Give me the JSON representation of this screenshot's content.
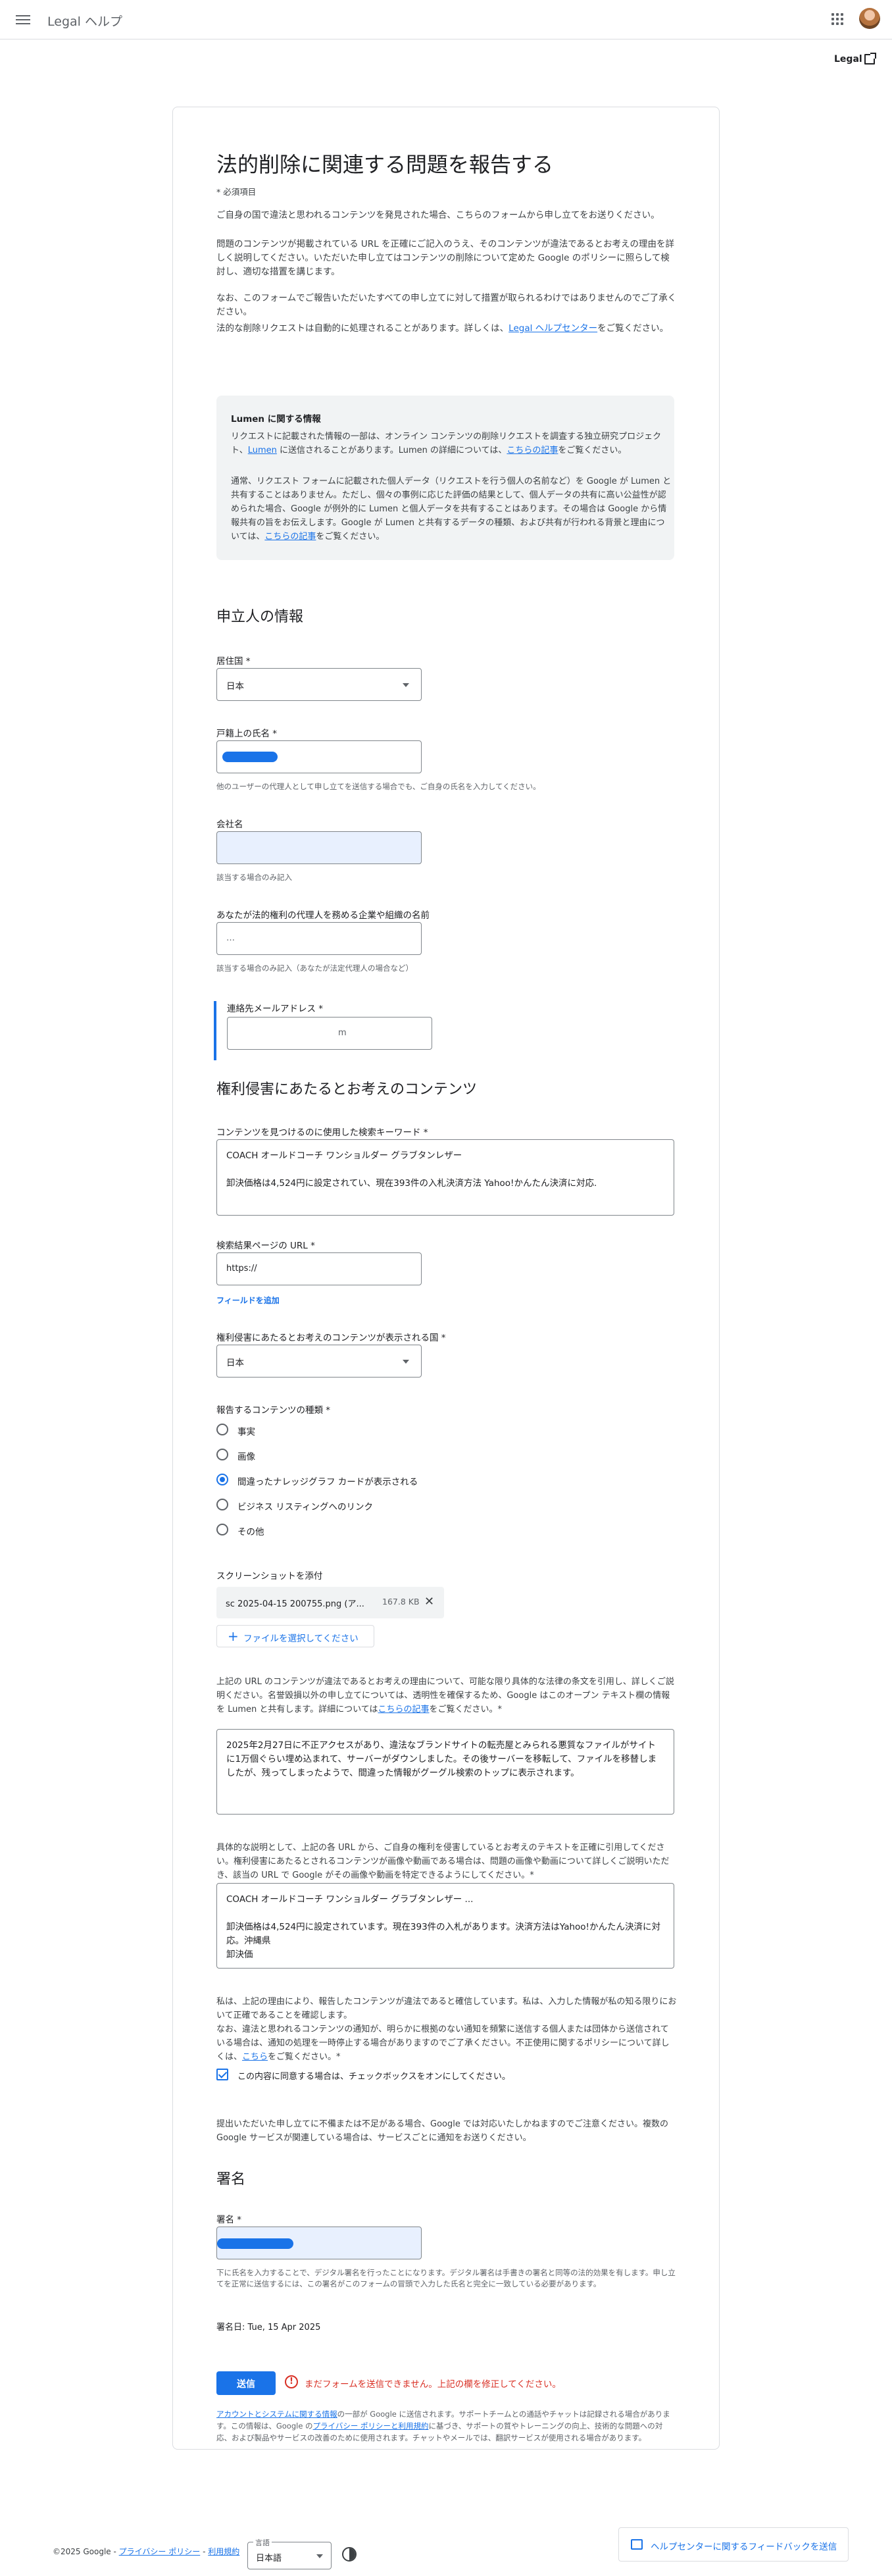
{
  "topbar": {
    "brand": "Legal ヘルプ",
    "legal_link": "Legal"
  },
  "form": {
    "title": "法的削除に関連する問題を報告する",
    "required_note": "* 必須項目",
    "intro": [
      "ご自身の国で違法と思われるコンテンツを発見された場合、こちらのフォームから申し立てをお送りください。",
      "問題のコンテンツが掲載されている URL を正確にご記入のうえ、そのコンテンツが違法であるとお考えの理由を詳しく説明してください。いただいた申し立てはコンテンツの削除について定めた Google のポリシーに照らして検討し、適切な措置を講じます。",
      "なお、このフォームでご報告いただいたすべての申し立てに対して措置が取られるわけではありませんのでご了承ください。"
    ],
    "intro_auto_prefix": "法的な削除リクエストは自動的に処理されることがあります。詳しくは、",
    "intro_auto_link": "Legal ヘルプセンター",
    "intro_auto_suffix": "をご覧ください。",
    "lumen": {
      "heading": "Lumen に関する情報",
      "p1_prefix": "リクエストに記載された情報の一部は、オンライン コンテンツの削除リクエストを調査する独立研究プロジェクト、",
      "p1_link": "Lumen",
      "p1_mid": " に送信されることがあります。Lumen の詳細については、",
      "p1_link2": "こちらの記事",
      "p1_suffix": "をご覧ください。",
      "p2_prefix": "通常、リクエスト フォームに記載された個人データ（リクエストを行う個人の名前など）を Google が Lumen と共有することはありません。ただし、個々の事例に応じた評価の結果として、個人データの共有に高い公益性が認められた場合、Google が例外的に Lumen と個人データを共有することはあります。その場合は Google から情報共有の旨をお伝えします。Google が Lumen と共有するデータの種類、および共有が行われる背景と理由については、",
      "p2_link": "こちらの記事",
      "p2_suffix": "をご覧ください。"
    },
    "requester_section": "申立人の情報",
    "country_label": "居住国 *",
    "country_value": "日本",
    "legal_name_label": "戸籍上の氏名 *",
    "legal_name_help": "他のユーザーの代理人として申し立てを送信する場合でも、ご自身の氏名を入力してください。",
    "company_label": "会社名",
    "company_help": "該当する場合のみ記入",
    "represent_label": "あなたが法的権利の代理人を務める企業や組織の名前",
    "represent_value": "…",
    "represent_help": "該当する場合のみ記入（あなたが法定代理人の場合など）",
    "email_label": "連絡先メールアドレス *",
    "email_value": "m",
    "content_section": "権利侵害にあたるとお考えのコンテンツ",
    "keywords_label": "コンテンツを見つけるのに使用した検索キーワード *",
    "keywords_value": "COACH オールドコーチ ワンショルダー グラブタンレザー\n\n卸決価格は4,524円に設定されてい、現在393件の入札決済方法 Yahoo!かんたん決済に対応.",
    "url_label": "検索結果ページの URL *",
    "url_value": "https://",
    "add_field": "フィールドを追加",
    "shown_country_label": "権利侵害にあたるとお考えのコンテンツが表示される国 *",
    "shown_country_value": "日本",
    "content_type_label": "報告するコンテンツの種類 *",
    "content_types": [
      "事実",
      "画像",
      "間違ったナレッジグラフ カードが表示される",
      "ビジネス リスティングへのリンク",
      "その他"
    ],
    "content_type_selected": 2,
    "screenshot_label": "スクリーンショットを添付",
    "file_name": "sc 2025-04-15 200755.png (ア...",
    "file_size": "167.8 KB",
    "choose_file": "ファイルを選択してください",
    "reason_label_prefix": "上記の URL のコンテンツが違法であるとお考えの理由について、可能な限り具体的な法律の条文を引用し、詳しくご説明ください。名誉毀損以外の申し立てについては、透明性を確保するため、Google はこのオープン テキスト欄の情報を Lumen と共有します。詳細については",
    "reason_label_link": "こちらの記事",
    "reason_label_suffix": "をご覧ください。*",
    "reason_value": "2025年2月27日に不正アクセスがあり、違法なブランドサイトの転売屋とみられる悪質なファイルがサイトに1万個ぐらい埋め込まれて、サーバーがダウンしました。その後サーバーを移転して、ファイルを移替しましたが、残ってしまったようで、間違った情報がグーグル検索のトップに表示されます。",
    "quote_label": "具体的な説明として、上記の各 URL から、ご自身の権利を侵害しているとお考えのテキストを正確に引用してください。権利侵害にあたるとされるコンテンツが画像や動画である場合は、問題の画像や動画について詳しくご説明いただき、該当の URL で Google がその画像や動画を特定できるようにしてください。*",
    "quote_value": "COACH オールドコーチ ワンショルダー グラブタンレザー ...\n\n卸決価格は4,524円に設定されています。現在393件の入札があります。決済方法はYahoo!かんたん決済に対応。沖縄県\n卸決価",
    "declaration_text": "私は、上記の理由により、報告したコンテンツが違法であると確信しています。私は、入力した情報が私の知る限りにおいて正確であることを確認します。\nなお、違法と思われるコンテンツの通知が、明らかに根拠のない通知を頻繁に送信する個人または団体から送信されている場合は、通知の処理を一時停止する場合がありますのでご了承ください。不正使用に関するポリシーについて詳しくは、",
    "declaration_link": "こちら",
    "declaration_suffix": "をご覧ください。*",
    "agree_label": "この内容に同意する場合は、チェックボックスをオンにしてください。",
    "notice": "提出いただいた申し立てに不備または不足がある場合、Google では対応いたしかねますのでご注意ください。複数の Google サービスが関連している場合は、サービスごとに通知をお送りください。",
    "signature_section": "署名",
    "signature_label": "署名 *",
    "signature_help": "下に氏名を入力することで、デジタル署名を行ったことになります。デジタル署名は手書きの署名と同等の法的効果を有します。申し立てを正常に送信するには、この署名がこのフォームの冒頭で入力した氏名と完全に一致している必要があります。",
    "signed_on": "署名日: Tue, 15 Apr 2025",
    "submit": "送信",
    "error": "まだフォームを送信できません。上記の欄を修正してください。",
    "footer_note_link": "アカウントとシステムに関する情報",
    "footer_note_1": "の一部が Google に送信されます。サポートチームとの通話やチャットは記録される場合があります。この情報は、Google の",
    "footer_note_link2": "プライバシー ポリシーと利用規約",
    "footer_note_2": "に基づき、サポートの質やトレーニングの向上、技術的な問題への対応、および製品やサービスの改善のために使用されます。チャットやメールでは、翻訳サービスが使用される場合があります。"
  },
  "footer": {
    "copyright": "©2025 Google -",
    "privacy": "プライバシー ポリシー",
    "sep": "-",
    "terms": "利用規約",
    "lang_label": "言語",
    "lang_value": "日本語",
    "feedback": "ヘルプセンターに関するフィードバックを送信"
  }
}
